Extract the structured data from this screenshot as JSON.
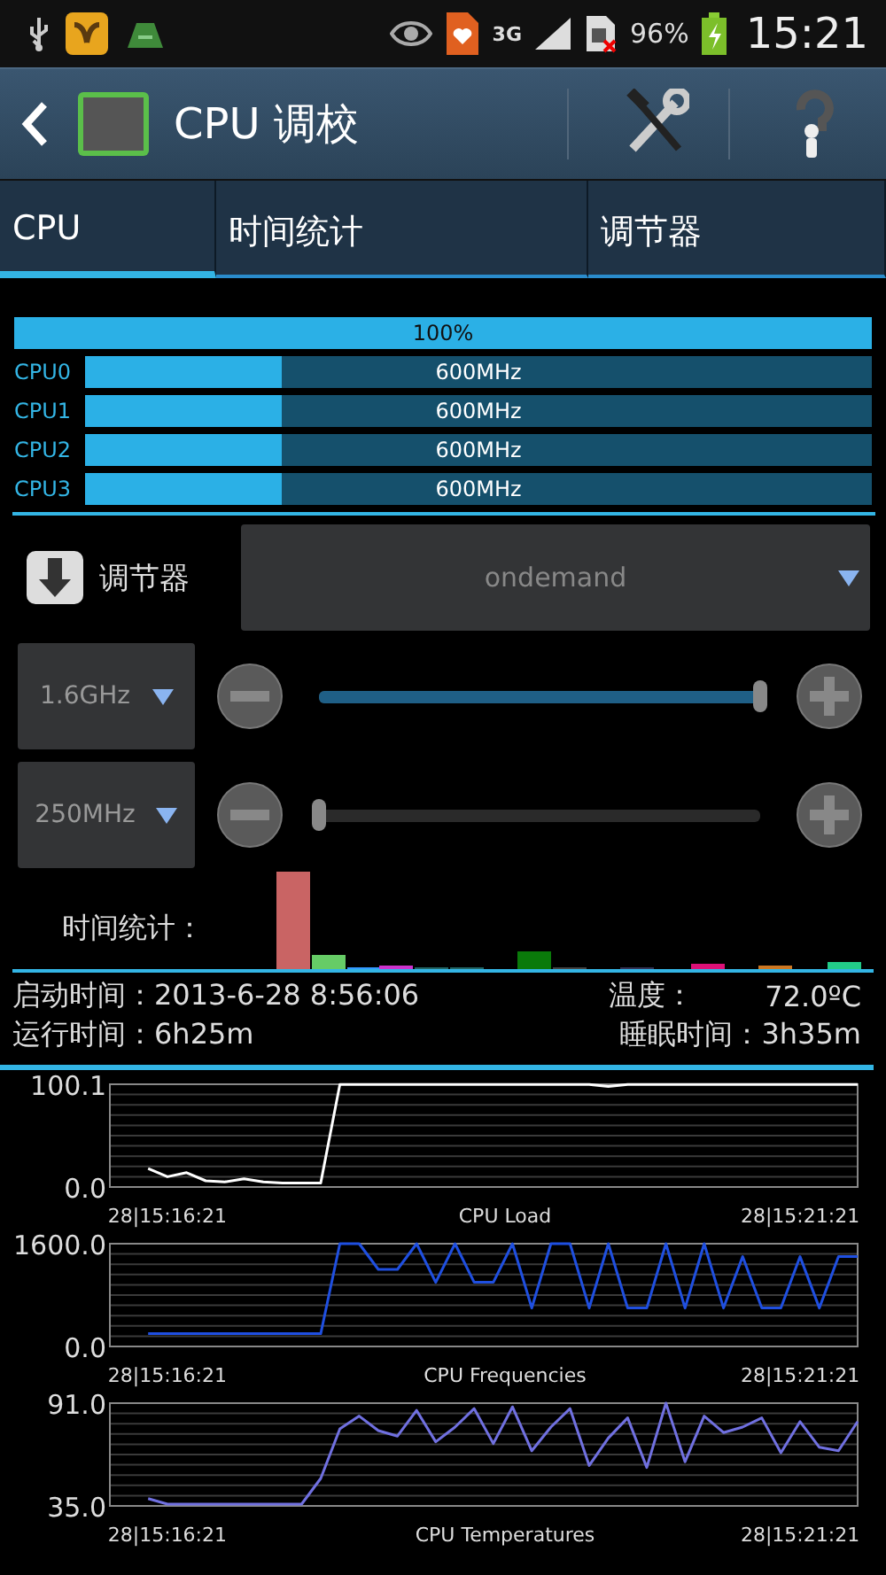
{
  "status_bar": {
    "network": "3G",
    "battery": "96%",
    "time": "15:21"
  },
  "action_bar": {
    "title": "CPU 调校"
  },
  "tabs": [
    {
      "label": "CPU",
      "selected": true
    },
    {
      "label": "时间统计",
      "selected": false
    },
    {
      "label": "调节器",
      "selected": false
    }
  ],
  "usage": {
    "total": {
      "reading": "100%",
      "level": 1
    },
    "cores": [
      {
        "name": "CPU0",
        "reading": "600MHz",
        "level": 0.25
      },
      {
        "name": "CPU1",
        "reading": "600MHz",
        "level": 0.25
      },
      {
        "name": "CPU2",
        "reading": "600MHz",
        "level": 0.25
      },
      {
        "name": "CPU3",
        "reading": "600MHz",
        "level": 0.25
      }
    ]
  },
  "governor": {
    "label": "调节器",
    "value": "ondemand"
  },
  "frequency_limits": [
    {
      "value": "1.6GHz",
      "level": 1
    },
    {
      "value": "250MHz",
      "level": 0
    }
  ],
  "time_stats": {
    "label": "时间统计："
  },
  "info": {
    "boot_time": "启动时间：2013-6-28 8:56:06",
    "temperature_label": "温度：",
    "temperature": "72.0ºC",
    "uptime": "运行时间：6h25m",
    "sleep_time": "睡眠时间：3h35m"
  },
  "charts": [
    {
      "chart_data": {
        "type": "line",
        "title": "CPU Load",
        "categories": [
          null,
          null,
          null,
          "28|15:16:21",
          null,
          null,
          null,
          null,
          null,
          null,
          null,
          null,
          null,
          null,
          null,
          null,
          null,
          null,
          null,
          null,
          null,
          null,
          null,
          null,
          null,
          null,
          null,
          null,
          null,
          null,
          null,
          null,
          null,
          null,
          null,
          null,
          "28|15:21:21",
          null,
          null,
          null
        ],
        "series": [
          {
            "color": "#ffffff",
            "values": [
              null,
              null,
              18,
              10,
              14,
              6,
              5,
              8,
              5,
              4,
              4,
              4,
              100,
              100,
              100,
              100,
              100,
              100,
              100,
              100,
              100,
              100,
              100,
              100,
              100,
              100,
              98,
              100,
              100,
              100,
              100,
              100,
              100,
              100,
              100,
              100,
              100,
              100,
              100,
              100
            ]
          }
        ],
        "ylim": [
          0,
          100.1
        ],
        "yticks": [
          {
            "value": 0,
            "label": "0.0"
          },
          {
            "value": 100.1,
            "label": "100.1"
          }
        ]
      }
    },
    {
      "chart_data": {
        "type": "line",
        "title": "CPU Frequencies",
        "categories": [
          null,
          null,
          null,
          "28|15:16:21",
          null,
          null,
          null,
          null,
          null,
          null,
          null,
          null,
          null,
          null,
          null,
          null,
          null,
          null,
          null,
          null,
          null,
          null,
          null,
          null,
          null,
          null,
          null,
          null,
          null,
          null,
          null,
          null,
          null,
          null,
          null,
          null,
          "28|15:21:21",
          null,
          null,
          null
        ],
        "series": [
          {
            "color": "#1f4fe0",
            "values": [
              null,
              null,
              200,
              200,
              200,
              200,
              200,
              200,
              200,
              200,
              200,
              200,
              1600,
              1600,
              1200,
              1200,
              1600,
              1000,
              1600,
              1000,
              1000,
              1600,
              600,
              1600,
              1600,
              600,
              1600,
              600,
              600,
              1600,
              600,
              1600,
              600,
              1400,
              600,
              600,
              1400,
              600,
              1400,
              1400
            ]
          }
        ],
        "ylim": [
          0,
          1600
        ],
        "yticks": [
          {
            "value": 0,
            "label": "0.0"
          },
          {
            "value": 1600,
            "label": "1600.0"
          }
        ]
      }
    },
    {
      "chart_data": {
        "type": "line",
        "title": "CPU Temperatures",
        "categories": [
          null,
          null,
          null,
          "28|15:16:21",
          null,
          null,
          null,
          null,
          null,
          null,
          null,
          null,
          null,
          null,
          null,
          null,
          null,
          null,
          null,
          null,
          null,
          null,
          null,
          null,
          null,
          null,
          null,
          null,
          null,
          null,
          null,
          null,
          null,
          null,
          null,
          null,
          "28|15:21:21",
          null,
          null,
          null
        ],
        "series": [
          {
            "color": "#7070e0",
            "values": [
              null,
              null,
              39,
              36,
              36,
              36,
              36,
              36,
              36,
              36,
              36,
              50,
              77,
              84,
              76,
              73,
              87,
              70,
              78,
              88,
              69,
              89,
              65,
              78,
              88,
              57,
              72,
              83,
              56,
              91,
              59,
              84,
              75,
              78,
              83,
              64,
              81,
              67,
              65,
              81
            ]
          }
        ],
        "ylim": [
          35,
          91
        ],
        "yticks": [
          {
            "value": 35,
            "label": "35.0"
          },
          {
            "value": 91,
            "label": "91.0"
          }
        ]
      }
    }
  ]
}
